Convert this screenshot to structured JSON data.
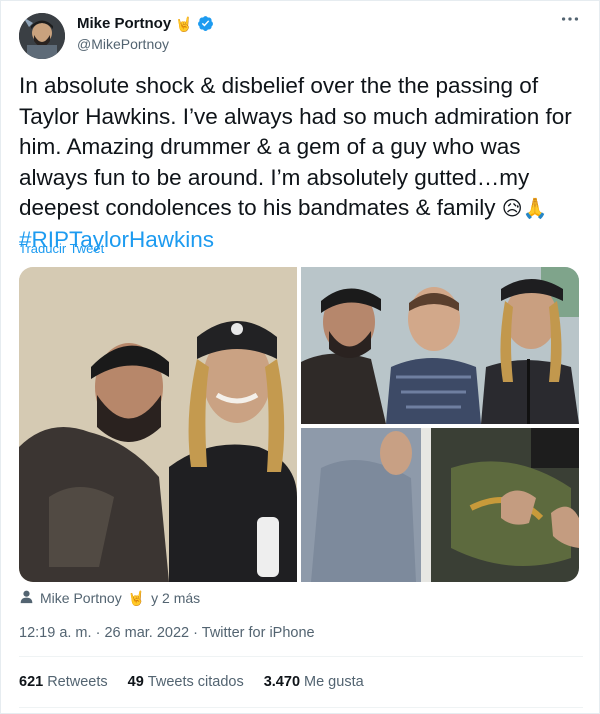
{
  "author": {
    "name": "Mike Portnoy",
    "name_emoji": "🤘",
    "handle": "@MikePortnoy",
    "verified": true,
    "avatar_icon": "avatar-photo"
  },
  "tweet": {
    "text": "In absolute shock & disbelief over the the passing of Taylor Hawkins. I’ve always had so much admiration for him. Amazing drummer & a gem of a guy who was always fun to be around. I’m absolutely gutted…my deepest condolences to his bandmates & family ",
    "emojis": "😥🙏",
    "hashtag": "#RIPTaylorHawkins",
    "translate_label": "Traducir Tweet"
  },
  "tagged": {
    "icon": "person-icon",
    "name": "Mike Portnoy",
    "emoji": "🤘",
    "suffix": "y 2 más"
  },
  "meta": {
    "time": "12:19 a. m.",
    "date": "26 mar. 2022",
    "source": "Twitter for iPhone",
    "separator": "·"
  },
  "stats": {
    "retweets_count": "621",
    "retweets_label": "Retweets",
    "quotes_count": "49",
    "quotes_label": "Tweets citados",
    "likes_count": "3.470",
    "likes_label": "Me gusta"
  },
  "colors": {
    "accent": "#1d9bf0",
    "text": "#0f1419",
    "muted": "#536471"
  }
}
